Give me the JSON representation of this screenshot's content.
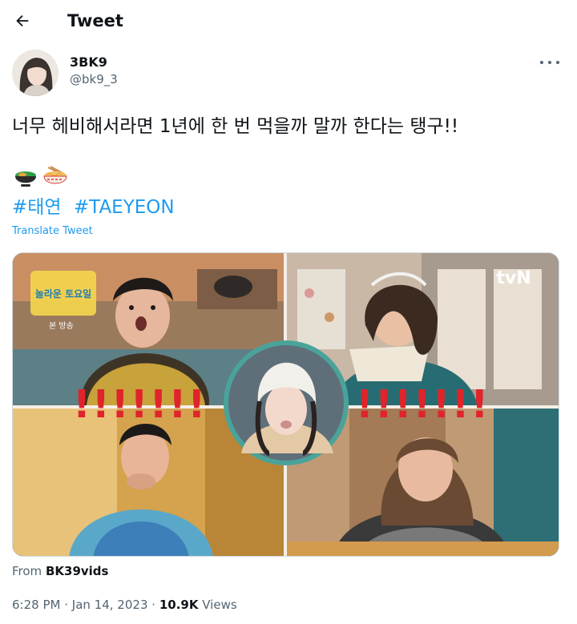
{
  "header": {
    "title": "Tweet",
    "back_icon": "arrow-left-icon"
  },
  "author": {
    "display_name": "3BK9",
    "handle": "@bk9_3"
  },
  "tweet": {
    "text": "너무 헤비해서라면 1년에 한 번 먹을까 말까 한다는 탱구!!",
    "emojis": [
      "curry-bowl-emoji",
      "ramen-bowl-emoji"
    ],
    "hashtags": [
      "#태연",
      "#TAEYEON"
    ],
    "translate_label": "Translate Tweet"
  },
  "media": {
    "show_logo": "놀라운 토요일",
    "show_subtitle": "본 방송",
    "channel_logo": "tvN",
    "exclaim_left": "!!!!!!!",
    "exclaim_right": "!!!!!!!"
  },
  "source": {
    "prefix": "From",
    "name": "BK39vids"
  },
  "meta": {
    "time": "6:28 PM",
    "separator": "·",
    "date": "Jan 14, 2023",
    "views_count": "10.9K",
    "views_label": "Views"
  },
  "colors": {
    "link": "#1d9bf0",
    "muted": "#536471",
    "text": "#0f1419",
    "exclaim": "#e0242b",
    "ring": "#4aa39a"
  }
}
